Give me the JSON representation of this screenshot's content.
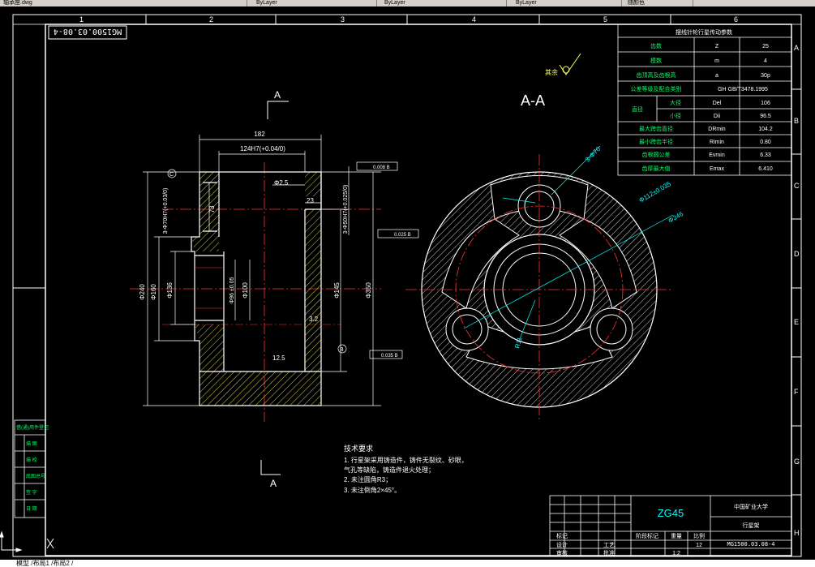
{
  "toolbar": {
    "file_tab": "轴承座.dwg",
    "layer_tabs": [
      "ByLayer",
      "ByLayer",
      "ByLayer",
      "ByLayer"
    ],
    "status": "随颜色"
  },
  "frame": {
    "columns": [
      "1",
      "2",
      "3",
      "4",
      "5",
      "6"
    ],
    "rows": [
      "A",
      "B",
      "C",
      "D",
      "E",
      "F",
      "G",
      "H"
    ],
    "mirror_code": "MG1500.03.08-4"
  },
  "section_labels": {
    "view_a_top": "A",
    "view_a_bottom": "A",
    "section_title": "A-A"
  },
  "roughness_other": "其余",
  "left_view_dims": {
    "d182": "182",
    "d124": "124H7(+0.04/0)",
    "d25": "Φ2.5",
    "d23": "23",
    "d73": "73",
    "d70": "3-Φ70H7(+0.03/0)",
    "d50": "3-Φ50H7(+0.025/0)",
    "d240": "Φ240",
    "d160": "Φ160",
    "d136": "Φ136",
    "d96": "Φ96 ±0.05",
    "d100": "Φ100",
    "d145": "Φ145",
    "d350": "Φ350",
    "r32": "3.2",
    "r125": "12.5",
    "tol1": "0.008 B",
    "tol2": "0.025 B",
    "tol3": "0.035 B",
    "datum_b": "B",
    "datum_c": "C"
  },
  "right_view_dims": {
    "d70": "3-Φ70",
    "d112": "Φ112±0.035",
    "d246": "Φ246",
    "r11": "R11"
  },
  "gear_params": {
    "title": "摆线针轮行星传动参数",
    "rows": [
      {
        "name": "齿数",
        "sym": "Z",
        "val": "25"
      },
      {
        "name": "模数",
        "sym": "m",
        "val": "4"
      },
      {
        "name": "齿顶高及齿根高",
        "sym": "a",
        "val": "30p"
      },
      {
        "name": "公差等级及配合类别",
        "sym": "",
        "val": "GH GB/T3478.1995"
      },
      {
        "name": "大径",
        "sym": "Del",
        "val": "106"
      },
      {
        "name": "小径",
        "sym": "Dii",
        "val": "96.5"
      },
      {
        "name": "最大跨齿直径",
        "sym": "DRmin",
        "val": "104.2"
      },
      {
        "name": "最小跨齿半径",
        "sym": "Rimin",
        "val": "0.80"
      },
      {
        "name": "齿根圆公差",
        "sym": "Evmin",
        "val": "6.33"
      },
      {
        "name": "齿厚最大值",
        "sym": "Emax",
        "val": "6.410"
      }
    ],
    "group_label": "直径"
  },
  "tech_req": {
    "title": "技术要求",
    "lines": [
      "1. 行星架采用铸造件，铸件无裂纹、砂眼，",
      "气孔等缺陷，铸造件退火处理；",
      "2. 未注圆角R3；",
      "3. 未注倒角2×45°。"
    ]
  },
  "title_block": {
    "material": "ZG45",
    "school": "中国矿业大学",
    "part_name": "行星架",
    "drawing_no": "MG1500.03.08-4",
    "scale": "1:2",
    "count": "12",
    "label_a": "标记",
    "label_b": "设计",
    "label_c": "审核",
    "label_d": "工艺",
    "label_e": "批准",
    "label_f": "阶段标记",
    "label_g": "重量",
    "label_h": "比例"
  },
  "left_stamp": [
    "借(通)用件登记",
    "描 图",
    "描 校",
    "底图总号",
    "签 字",
    "日 期"
  ],
  "bottom_tabs": "模型 /布局1 /布局2 /"
}
